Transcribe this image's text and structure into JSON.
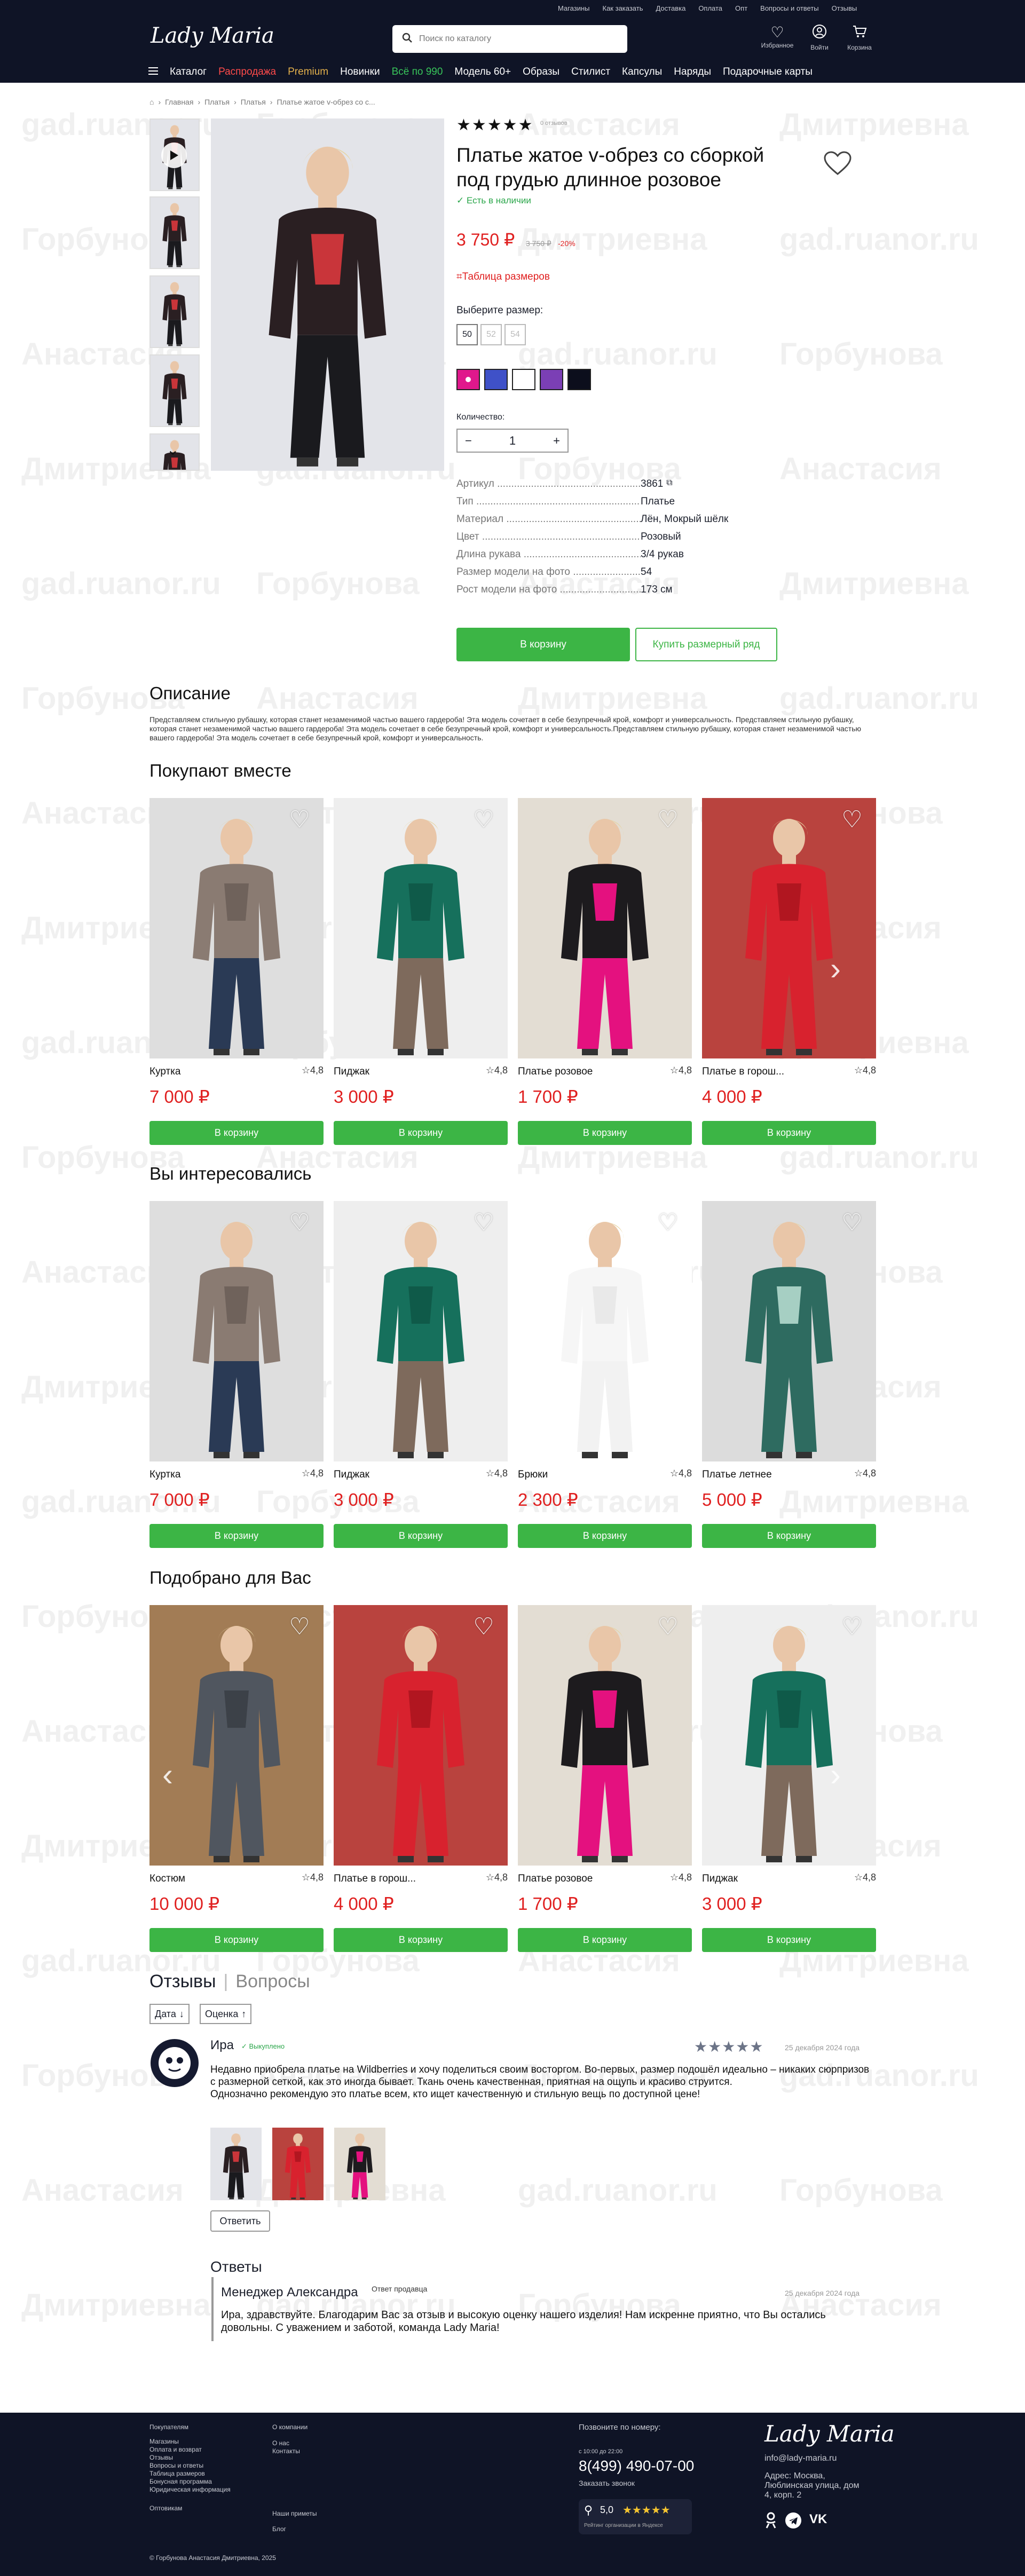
{
  "header": {
    "top_links": [
      "Магазины",
      "Как заказать",
      "Доставка",
      "Оплата",
      "Опт",
      "Вопросы и ответы",
      "Отзывы"
    ],
    "logo": "Lady Maria",
    "search_placeholder": "Поиск по каталогу",
    "icons": [
      {
        "icon": "heart-icon",
        "label": "Избранное"
      },
      {
        "icon": "user-icon",
        "label": "Войти"
      },
      {
        "icon": "cart-icon",
        "label": "Корзина"
      }
    ],
    "nav": [
      "Каталог",
      "Распродажа",
      "Premium",
      "Новинки",
      "Всё по 990",
      "Модель 60+",
      "Образы",
      "Стилист",
      "Капсулы",
      "Наряды",
      "Подарочные карты"
    ],
    "colors": {
      "bg": "#0f1426",
      "sale": "#ff4a4a",
      "premium": "#e3b04b",
      "green": "#38c45a"
    }
  },
  "watermark": [
    "gad.ruanor.ru",
    "Горбунова",
    "Анастасия",
    "Дмитриевна"
  ],
  "breadcrumbs": [
    "Главная",
    "Платья",
    "Платья",
    "Платье жатое v-обрез со с..."
  ],
  "product": {
    "rating_caption": "0 отзывов",
    "title": "Платье жатое v-обрез со сборкой под грудью длинное розовое",
    "stock": "✓ Есть в наличии",
    "price": "3 750 ₽",
    "old_price": "3 750 ₽",
    "discount": "-20%",
    "size_table": "Таблица размеров",
    "choose_size": "Выберите размер:",
    "sizes": [
      "50",
      "52",
      "54"
    ],
    "swatches": [
      "#e0188c",
      "#3f51c8",
      "#ffffff",
      "#7b3fb5",
      "#0c0e1c"
    ],
    "qty_label": "Количество:",
    "qty": "1",
    "attributes": [
      {
        "k": "Артикул",
        "v": "3861"
      },
      {
        "k": "Тип",
        "v": "Платье"
      },
      {
        "k": "Материал",
        "v": "Лён, Мокрый шёлк"
      },
      {
        "k": "Цвет",
        "v": "Розовый"
      },
      {
        "k": "Длина рукава",
        "v": "3/4 рукав"
      },
      {
        "k": "Размер модели на фото",
        "v": "54"
      },
      {
        "k": "Рост модели на фото",
        "v": "173 см"
      }
    ],
    "add_to_cart": "В корзину",
    "buy_size_row": "Купить размерный ряд"
  },
  "description": {
    "heading": "Описание",
    "text": "Представляем стильную рубашку, которая станет незаменимой частью вашего гардероба! Эта модель сочетает в себе безупречный крой, комфорт и универсальность. Представляем стильную рубашку, которая станет незаменимой частью вашего гардероба! Эта модель сочетает в себе безупречный крой, комфорт и универсальность.Представляем стильную рубашку, которая станет незаменимой частью вашего гардероба! Эта модель сочетает в себе безупречный крой, комфорт и универсальность."
  },
  "sections": [
    {
      "heading": "Покупают вместе",
      "items": [
        {
          "name": "Куртка",
          "rating": "4,8",
          "price": "7 000 ₽",
          "cart": "В корзину",
          "look": "jacket"
        },
        {
          "name": "Пиджак",
          "rating": "4,8",
          "price": "3 000 ₽",
          "cart": "В корзину",
          "look": "blazer"
        },
        {
          "name": "Платье розовое",
          "rating": "4,8",
          "price": "1 700 ₽",
          "cart": "В корзину",
          "look": "pink"
        },
        {
          "name": "Платье в горош...",
          "rating": "4,8",
          "price": "4 000 ₽",
          "cart": "В корзину",
          "look": "red"
        }
      ]
    },
    {
      "heading": "Вы интересовались",
      "items": [
        {
          "name": "Куртка",
          "rating": "4,8",
          "price": "7 000 ₽",
          "cart": "В корзину",
          "look": "jacket"
        },
        {
          "name": "Пиджак",
          "rating": "4,8",
          "price": "3 000 ₽",
          "cart": "В корзину",
          "look": "blazer"
        },
        {
          "name": "Брюки",
          "rating": "4,8",
          "price": "2 300 ₽",
          "cart": "В корзину",
          "look": "white"
        },
        {
          "name": "Платье летнее",
          "rating": "4,8",
          "price": "5 000 ₽",
          "cart": "В корзину",
          "look": "teal"
        }
      ]
    },
    {
      "heading": "Подобрано для Вас",
      "items": [
        {
          "name": "Костюм",
          "rating": "4,8",
          "price": "10 000 ₽",
          "cart": "В корзину",
          "look": "suit"
        },
        {
          "name": "Платье в горош...",
          "rating": "4,8",
          "price": "4 000 ₽",
          "cart": "В корзину",
          "look": "red"
        },
        {
          "name": "Платье розовое",
          "rating": "4,8",
          "price": "1 700 ₽",
          "cart": "В корзину",
          "look": "pink"
        },
        {
          "name": "Пиджак",
          "rating": "4,8",
          "price": "3 000 ₽",
          "cart": "В корзину",
          "look": "blazer"
        }
      ]
    }
  ],
  "reviews": {
    "tab_active": "Отзывы",
    "tab_inactive": "Вопросы",
    "sort_date": "Дата",
    "sort_rating": "Оценка",
    "author": "Ира",
    "badge": "✓ Выкуплено",
    "stars": 5,
    "date": "25 декабря 2024 года",
    "text": "Недавно приобрела платье на Wildberries и хочу поделиться своим восторгом. Во-первых, размер подошёл идеально – никаких сюрпризов с размерной сеткой, как это иногда бывает. Ткань очень качественная, приятная на ощупь и красиво струится.",
    "text2": "Однозначно рекомендую это платье всем, кто ищет качественную и стильную вещь по доступной цене!",
    "reply": "Ответить",
    "answers_label": "Ответы",
    "manager": "Менеджер Александра",
    "manager_badge": "Ответ продавца",
    "manager_date": "25 декабря 2024 года",
    "manager_text": "Ира, здравствуйте. Благодарим Вас за отзыв и высокую оценку нашего изделия! Нам искренне приятно, что Вы остались довольны. С уважением и заботой, команда Lady Maria!"
  },
  "footer": {
    "col1_title": "Покупателям",
    "col1": [
      "Магазины",
      "Оплата и возврат",
      "Отзывы",
      "Вопросы и ответы",
      "Таблица размеров",
      "Бонусная программа",
      "Юридическая информация"
    ],
    "col1_extra": "Оптовикам",
    "col2": [
      "О компании",
      "",
      "О нас",
      "Контакты"
    ],
    "col2_extra": [
      "Наши приметы",
      "Блог"
    ],
    "call_label": "Позвоните по номеру:",
    "hours": "с 10:00 до 22:00",
    "phone": "8(499) 490-07-00",
    "call_back": "Заказать звонок",
    "yandex_rating": "5,0",
    "yandex_caption": "Рейтинг организации в Яндексе",
    "logo": "Lady Maria",
    "email": "info@lady-maria.ru",
    "address": "Адрес: Москва, Люблинская улица, дом 4, корп. 2",
    "copyright": "© Горбунова Анастасия Дмитриевна, 2025"
  }
}
